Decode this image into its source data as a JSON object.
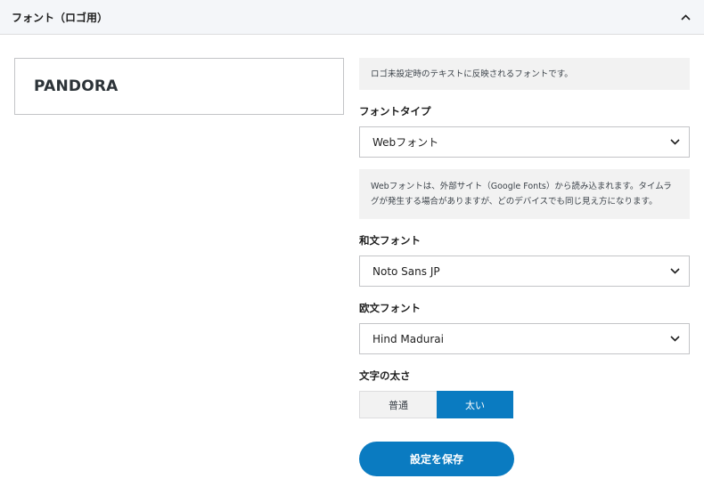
{
  "panel": {
    "title": "フォント（ロゴ用）",
    "collapse_icon": "chevron-up-icon"
  },
  "preview": {
    "text": "PANDORA"
  },
  "notes": {
    "intro": "ロゴ未設定時のテキストに反映されるフォントです。",
    "webfont_info": "Webフォントは、外部サイト（Google Fonts）から読み込まれます。タイムラグが発生する場合がありますが、どのデバイスでも同じ見え方になります。"
  },
  "font_type": {
    "label": "フォントタイプ",
    "value": "Webフォント"
  },
  "japanese_font": {
    "label": "和文フォント",
    "value": "Noto Sans JP"
  },
  "western_font": {
    "label": "欧文フォント",
    "value": "Hind Madurai"
  },
  "weight": {
    "label": "文字の太さ",
    "options": [
      "普通",
      "太い"
    ],
    "selected": "太い"
  },
  "save_button": {
    "label": "設定を保存"
  },
  "colors": {
    "accent": "#0a7bc1",
    "header_bg": "#f4f6f9",
    "note_bg": "#f2f2f2"
  }
}
